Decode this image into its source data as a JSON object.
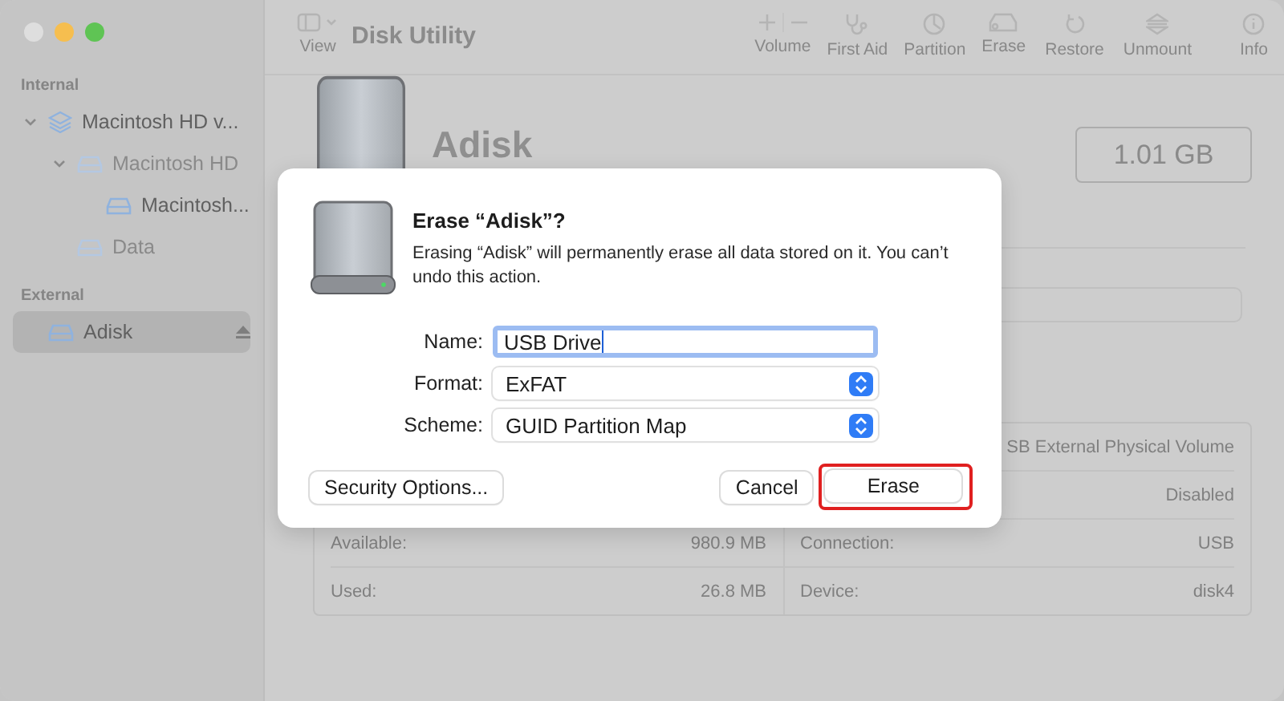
{
  "window": {
    "title": "Disk Utility"
  },
  "toolbar": [
    {
      "label": "View",
      "kind": "view"
    },
    {
      "label": "Volume",
      "kind": "volume"
    },
    {
      "label": "First Aid",
      "kind": "firstaid"
    },
    {
      "label": "Partition",
      "kind": "partition"
    },
    {
      "label": "Erase",
      "kind": "erase"
    },
    {
      "label": "Restore",
      "kind": "restore"
    },
    {
      "label": "Unmount",
      "kind": "unmount"
    },
    {
      "label": "Info",
      "kind": "info"
    }
  ],
  "sidebar": {
    "sections": [
      {
        "title": "Internal",
        "items": [
          {
            "label": "Macintosh HD v...",
            "kind": "stack",
            "dimmed": false,
            "selected": false,
            "expanded": true,
            "children": [
              {
                "label": "Macintosh HD",
                "kind": "drive",
                "dimmed": true,
                "selected": false,
                "expanded": true,
                "children": [
                  {
                    "label": "Macintosh...",
                    "kind": "drive",
                    "dimmed": false,
                    "selected": false
                  }
                ]
              },
              {
                "label": "Data",
                "kind": "drive",
                "dimmed": true,
                "selected": false
              }
            ]
          }
        ]
      },
      {
        "title": "External",
        "items": [
          {
            "label": "Adisk",
            "kind": "drive",
            "dimmed": false,
            "selected": true,
            "eject": true
          }
        ]
      }
    ]
  },
  "disk": {
    "name": "Adisk",
    "size": "1.01 GB"
  },
  "info_table": [
    {
      "right_value": "SB External Physical Volume"
    },
    {
      "right_value": "Disabled"
    },
    {
      "left_label": "Available:",
      "left_value": "980.9 MB",
      "right_label": "Connection:",
      "right_value": "USB"
    },
    {
      "left_label": "Used:",
      "left_value": "26.8 MB",
      "right_label": "Device:",
      "right_value": "disk4"
    }
  ],
  "dialog": {
    "title": "Erase “Adisk”?",
    "message": "Erasing “Adisk” will permanently erase all data stored on it. You can’t undo this action.",
    "fields": [
      {
        "label": "Name:",
        "kind": "text",
        "value": "USB Drive",
        "focused": true
      },
      {
        "label": "Format:",
        "kind": "select",
        "value": "ExFAT"
      },
      {
        "label": "Scheme:",
        "kind": "select",
        "value": "GUID Partition Map"
      }
    ],
    "buttons": [
      {
        "label": "Security Options...",
        "kind": "left",
        "highlighted": false
      },
      {
        "label": "Cancel",
        "kind": "right",
        "highlighted": false
      },
      {
        "label": "Erase",
        "kind": "right",
        "highlighted": true
      }
    ]
  }
}
